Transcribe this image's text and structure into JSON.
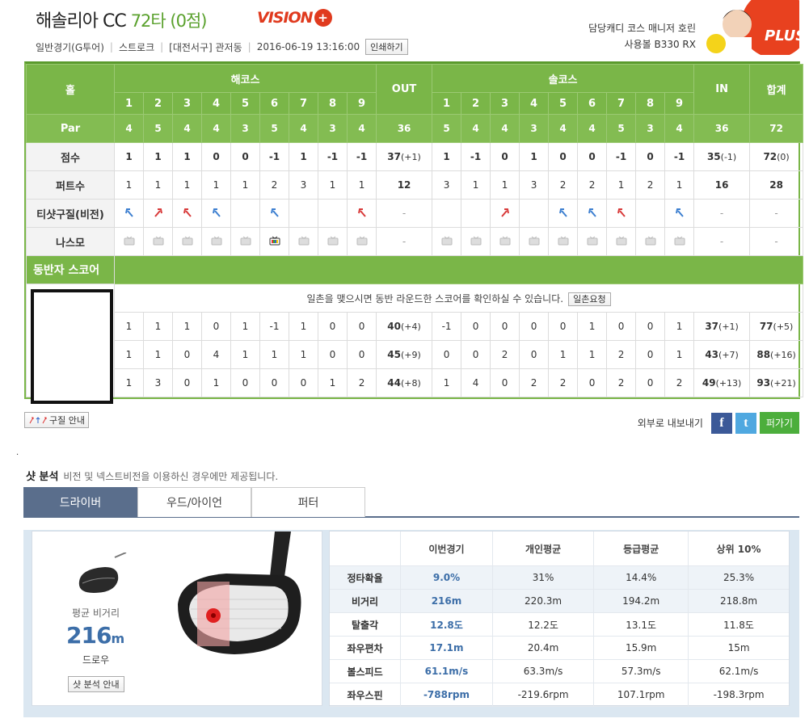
{
  "header": {
    "course": "해솔리아 CC",
    "score_text": "72타 (0점)",
    "logo_text": "VISION",
    "logo_plus": "+",
    "game_type": "일반경기(G투어)",
    "stroke": "스트로크",
    "location": "[대전서구] 관저동",
    "datetime": "2016-06-19 13:16:00",
    "print_label": "인쇄하기",
    "caddie": "담당캐디 코스 매니저 호린",
    "ball": "사용볼 B330 RX",
    "plus_logo_text": "PLUS"
  },
  "score": {
    "hole_label": "홀",
    "course1": "해코스",
    "course2": "솔코스",
    "out_label": "OUT",
    "in_label": "IN",
    "total_label": "합계",
    "holes": [
      "1",
      "2",
      "3",
      "4",
      "5",
      "6",
      "7",
      "8",
      "9"
    ],
    "par_label": "Par",
    "par1": [
      "4",
      "5",
      "4",
      "4",
      "3",
      "5",
      "4",
      "3",
      "4"
    ],
    "par_out": "36",
    "par2": [
      "5",
      "4",
      "4",
      "3",
      "4",
      "4",
      "5",
      "3",
      "4"
    ],
    "par_in": "36",
    "par_total": "72",
    "score_label": "점수",
    "score1": [
      "1",
      "1",
      "1",
      "0",
      "0",
      "-1",
      "1",
      "-1",
      "-1"
    ],
    "score_out": "37",
    "score_out_diff": "(+1)",
    "score2": [
      "1",
      "-1",
      "0",
      "1",
      "0",
      "0",
      "-1",
      "0",
      "-1"
    ],
    "score_in": "35",
    "score_in_diff": "(-1)",
    "score_total": "72",
    "score_total_diff": "(0)",
    "putt_label": "퍼트수",
    "putt1": [
      "1",
      "1",
      "1",
      "1",
      "1",
      "2",
      "3",
      "1",
      "1"
    ],
    "putt_out": "12",
    "putt2": [
      "3",
      "1",
      "1",
      "3",
      "2",
      "2",
      "1",
      "2",
      "1"
    ],
    "putt_in": "16",
    "putt_total": "28",
    "tee_label": "티샷구질(비전)",
    "tee1": [
      "left",
      "right",
      "left-red",
      "left",
      "",
      "left",
      "",
      "",
      "left-red"
    ],
    "tee2": [
      "",
      "",
      "right-red",
      "",
      "left",
      "left",
      "left-red",
      "",
      "left"
    ],
    "dash": "-",
    "nasmo_label": "나스모",
    "nasmo1": [
      "off",
      "off",
      "off",
      "off",
      "off",
      "on",
      "off",
      "off",
      "off"
    ],
    "nasmo2": [
      "off",
      "off",
      "off",
      "off",
      "off",
      "off",
      "off",
      "off",
      "off"
    ],
    "companion_label": "동반자 스코어",
    "companion_msg": "일촌을 맺으시면 동반 라운드한 스코어를 확인하실 수 있습니다.",
    "companion_btn": "일촌요청",
    "companions": [
      {
        "s1": [
          "1",
          "1",
          "1",
          "0",
          "1",
          "-1",
          "1",
          "0",
          "0"
        ],
        "out": "40",
        "out_d": "(+4)",
        "s2": [
          "-1",
          "0",
          "0",
          "0",
          "0",
          "1",
          "0",
          "0",
          "1"
        ],
        "in": "37",
        "in_d": "(+1)",
        "tot": "77",
        "tot_d": "(+5)"
      },
      {
        "s1": [
          "1",
          "1",
          "0",
          "4",
          "1",
          "1",
          "1",
          "0",
          "0"
        ],
        "out": "45",
        "out_d": "(+9)",
        "s2": [
          "0",
          "0",
          "2",
          "0",
          "1",
          "1",
          "2",
          "0",
          "1"
        ],
        "in": "43",
        "in_d": "(+7)",
        "tot": "88",
        "tot_d": "(+16)"
      },
      {
        "s1": [
          "1",
          "3",
          "0",
          "1",
          "0",
          "0",
          "0",
          "1",
          "2"
        ],
        "out": "44",
        "out_d": "(+8)",
        "s2": [
          "1",
          "4",
          "0",
          "2",
          "2",
          "0",
          "2",
          "0",
          "2"
        ],
        "in": "49",
        "in_d": "(+13)",
        "tot": "93",
        "tot_d": "(+21)"
      }
    ]
  },
  "below": {
    "legend_label": "구질 안내",
    "share_label": "외부로 내보내기",
    "fb": "f",
    "tw": "t",
    "pg": "퍼가기",
    "dot": "."
  },
  "shot": {
    "title": "샷 분석",
    "note": "비전 및 넥스트비전을 이용하신 경우에만 제공됩니다.",
    "tabs": [
      "드라이버",
      "우드/아이언",
      "퍼터"
    ],
    "avg_label": "평균 비거리",
    "avg_value": "216",
    "avg_unit": "m",
    "shape": "드로우",
    "guide": "샷 분석 안내",
    "cols": [
      "이번경기",
      "개인평균",
      "등급평균",
      "상위 10%"
    ],
    "rows": [
      {
        "k": "정타확율",
        "v": [
          "9.0%",
          "31%",
          "14.4%",
          "25.3%"
        ]
      },
      {
        "k": "비거리",
        "v": [
          "216m",
          "220.3m",
          "194.2m",
          "218.8m"
        ]
      },
      {
        "k": "탈출각",
        "v": [
          "12.8도",
          "12.2도",
          "13.1도",
          "11.8도"
        ]
      },
      {
        "k": "좌우편차",
        "v": [
          "17.1m",
          "20.4m",
          "15.9m",
          "15m"
        ]
      },
      {
        "k": "볼스피드",
        "v": [
          "61.1m/s",
          "63.3m/s",
          "57.3m/s",
          "62.1m/s"
        ]
      },
      {
        "k": "좌우스핀",
        "v": [
          "-788rpm",
          "-219.6rpm",
          "107.1rpm",
          "-198.3rpm"
        ]
      }
    ]
  },
  "colors": {
    "green": "#7ab648",
    "accent_blue": "#3c6ea8",
    "brand_red": "#e03a1e",
    "tab_active": "#5a6e8c"
  }
}
